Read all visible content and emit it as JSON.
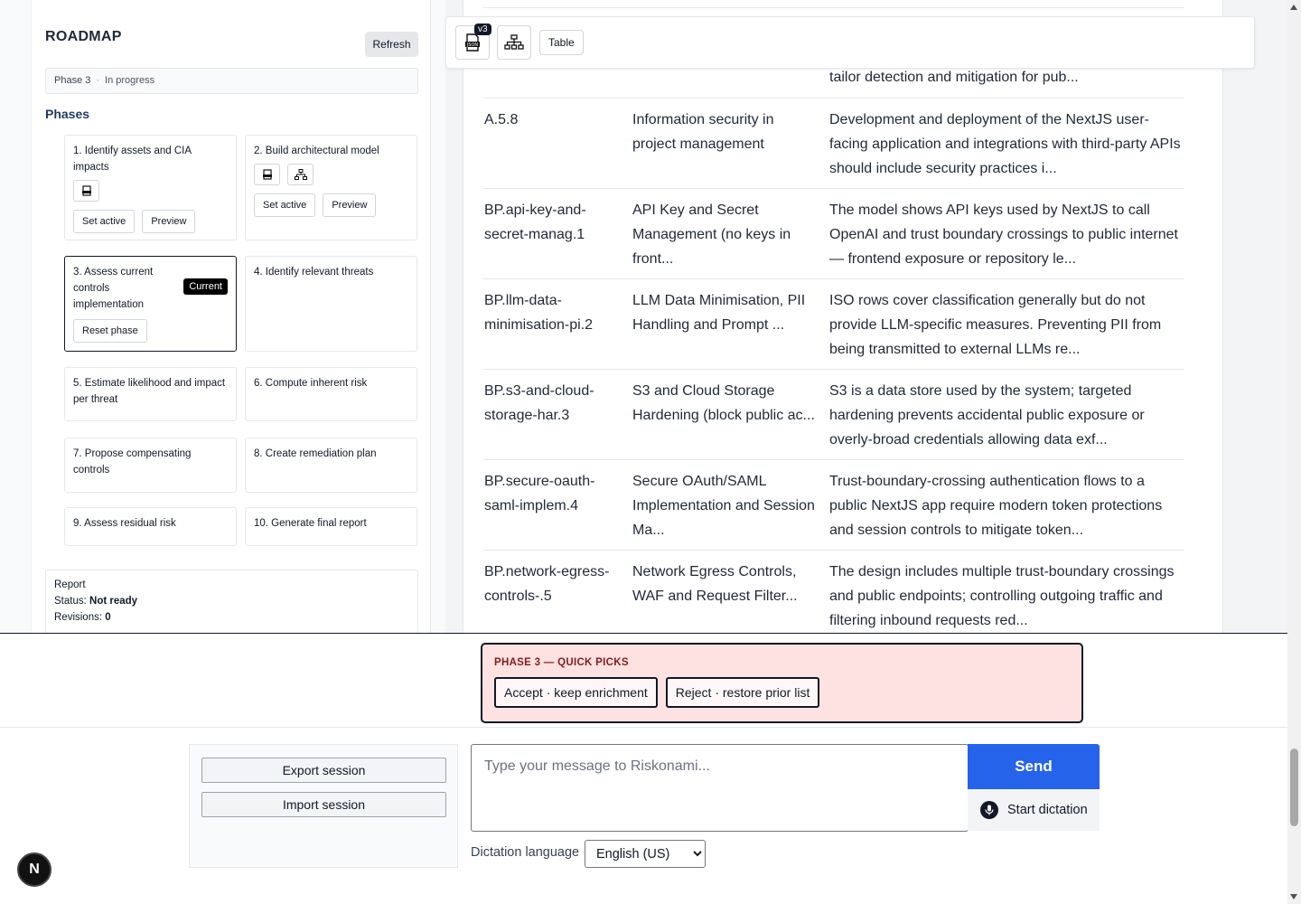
{
  "roadmap": {
    "title": "ROADMAP",
    "refresh_label": "Refresh",
    "phase_label": "Phase 3",
    "phase_status": "In progress",
    "phases_heading": "Phases",
    "phases": [
      {
        "title": "1. Identify assets and CIA impacts",
        "set_active": "Set active",
        "preview": "Preview"
      },
      {
        "title": "2. Build architectural model",
        "set_active": "Set active",
        "preview": "Preview"
      },
      {
        "title": "3. Assess current controls implementation",
        "badge": "Current",
        "reset": "Reset phase"
      },
      {
        "title": "4. Identify relevant threats"
      },
      {
        "title": "5. Estimate likelihood and impact per threat"
      },
      {
        "title": "6. Compute inherent risk"
      },
      {
        "title": "7. Propose compensating controls"
      },
      {
        "title": "8. Create remediation plan"
      },
      {
        "title": "9. Assess residual risk"
      },
      {
        "title": "10. Generate final report"
      }
    ],
    "report": {
      "title": "Report",
      "status_label": "Status:",
      "status_value": "Not ready",
      "revisions_label": "Revisions:",
      "revisions_value": "0"
    }
  },
  "toolbar": {
    "version_badge": "v3",
    "table_label": "Table"
  },
  "table": {
    "partial_text": "tailor detection and mitigation for pub...",
    "rows": [
      {
        "id": "A.5.8",
        "name": "Information security in project management",
        "desc": "Development and deployment of the NextJS user-facing application and integrations with third-party APIs should include security practices i..."
      },
      {
        "id": "BP.api-key-and-secret-manag.1",
        "name": "API Key and Secret Management (no keys in front...",
        "desc": "The model shows API keys used by NextJS to call OpenAI and trust boundary crossings to public internet — frontend exposure or repository le..."
      },
      {
        "id": "BP.llm-data-minimisation-pi.2",
        "name": "LLM Data Minimisation, PII Handling and Prompt ...",
        "desc": "ISO rows cover classification generally but do not provide LLM-specific measures. Preventing PII from being transmitted to external LLMs re..."
      },
      {
        "id": "BP.s3-and-cloud-storage-har.3",
        "name": "S3 and Cloud Storage Hardening (block public ac...",
        "desc": "S3 is a data store used by the system; targeted hardening prevents accidental public exposure or overly-broad credentials allowing data exf..."
      },
      {
        "id": "BP.secure-oauth-saml-implem.4",
        "name": "Secure OAuth/SAML Implementation and Session Ma...",
        "desc": "Trust-boundary-crossing authentication flows to a public NextJS app require modern token protections and session controls to mitigate token..."
      },
      {
        "id": "BP.network-egress-controls-.5",
        "name": "Network Egress Controls, WAF and Request Filter...",
        "desc": "The design includes multiple trust-boundary crossings and public endpoints; controlling outgoing traffic and filtering inbound requests red..."
      }
    ]
  },
  "quick_picks": {
    "title": "PHASE 3 — QUICK PICKS",
    "accept": "Accept · keep enrichment",
    "reject": "Reject · restore prior list"
  },
  "session": {
    "export": "Export session",
    "import": "Import session"
  },
  "composer": {
    "placeholder": "Type your message to Riskonami...",
    "send": "Send",
    "dictation": "Start dictation",
    "dictation_language_label": "Dictation language",
    "dictation_language_value": "English (US)"
  },
  "dev_badge": "N"
}
